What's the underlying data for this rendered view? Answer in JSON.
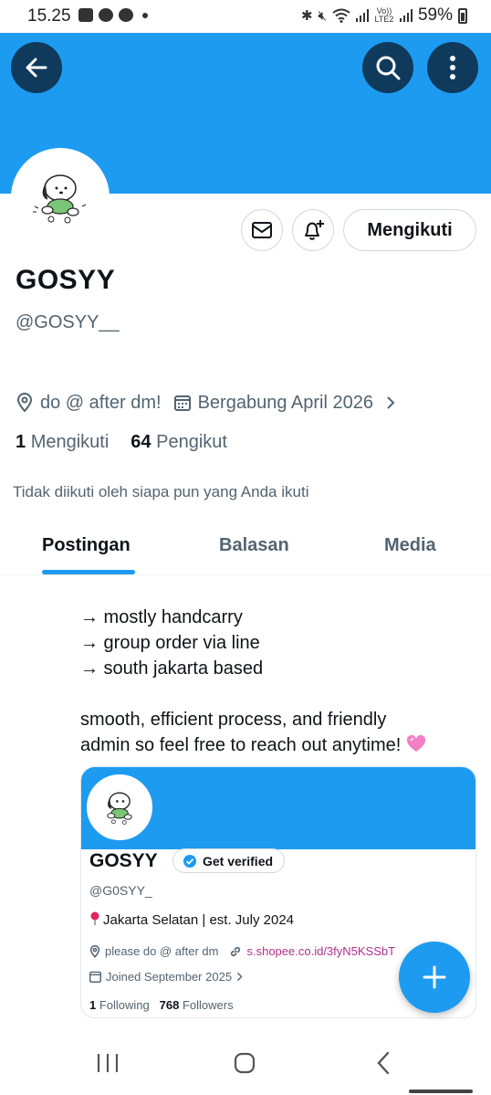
{
  "status_bar": {
    "time": "15.25",
    "network_label": "Vo)) LTE2",
    "battery": "59%"
  },
  "header": {
    "back_icon": "arrow-left-icon",
    "search_icon": "search-icon",
    "more_icon": "more-vertical-icon",
    "banner_color": "#1d9bf0"
  },
  "profile": {
    "name": "GOSYY",
    "handle": "@GOSYY__",
    "follow_button": "Mengikuti",
    "location": "do @ after dm!",
    "joined": "Bergabung April 2026",
    "following_count": "1",
    "following_label": "Mengikuti",
    "followers_count": "64",
    "followers_label": "Pengikut",
    "not_followed_text": "Tidak diikuti oleh siapa pun yang Anda ikuti"
  },
  "tabs": [
    {
      "label": "Postingan",
      "active": true
    },
    {
      "label": "Balasan",
      "active": false
    },
    {
      "label": "Media",
      "active": false
    }
  ],
  "post": {
    "lines": [
      "→ mostly handcarry",
      "→ group order via line",
      "→ south jakarta based",
      "smooth, efficient process, and friendly",
      "admin so feel free to reach out anytime!"
    ],
    "emoji": "pink-heart"
  },
  "embedded_card": {
    "name": "GOSYY",
    "badge": "Get verified",
    "handle": "@G0SYY_",
    "bio": "Jakarta Selatan | est. July 2024",
    "location": "please do @ after dm",
    "link": "s.shopee.co.id/3fyN5KSSbT",
    "joined": "Joined September 2025",
    "following_count": "1",
    "following_label": "Following",
    "followers_count": "768",
    "followers_label": "Followers"
  },
  "colors": {
    "accent": "#1d9bf0",
    "dark_button": "#0f3a5c",
    "secondary_text": "#536471",
    "link": "#b0308e"
  }
}
